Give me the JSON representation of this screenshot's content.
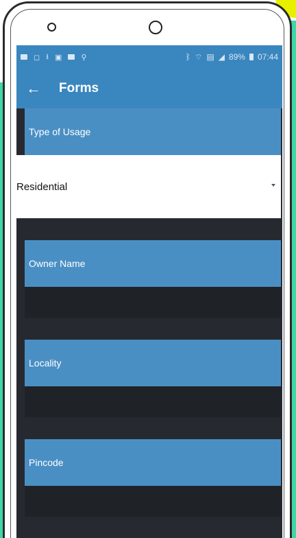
{
  "status_bar": {
    "battery": "89%",
    "time": "07:44"
  },
  "toolbar": {
    "title": "Forms"
  },
  "form": {
    "type_of_usage_label": "Type of Usage",
    "type_of_usage_value": "Residential",
    "owner_name_label": "Owner Name",
    "owner_name_value": "",
    "locality_label": "Locality",
    "locality_value": "",
    "pincode_label": "Pincode",
    "pincode_value": ""
  },
  "colors": {
    "primary": "#3a86bf",
    "field_header": "#4a8fc4",
    "background": "#262a30",
    "input_bg": "#1f2226"
  }
}
